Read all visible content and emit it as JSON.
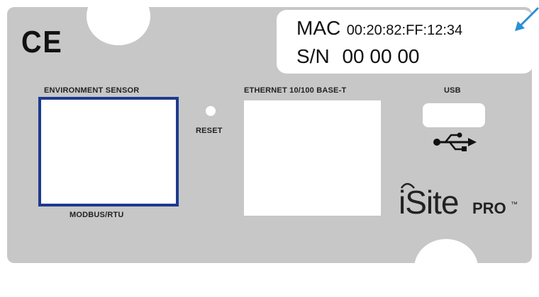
{
  "panel": {
    "ce_mark": "CE",
    "mac_label": "MAC",
    "mac_address": "00:20:82:FF:12:34",
    "sn_label": "S/N",
    "serial_number": "00 00 00",
    "env_sensor_label": "ENVIRONMENT SENSOR",
    "modbus_label": "MODBUS/RTU",
    "reset_label": "RESET",
    "ethernet_label": "ETHERNET 10/100 BASE-T",
    "usb_label": "USB",
    "logo_text": "iSite",
    "logo_suffix": "PRO",
    "logo_tm": "™"
  },
  "icons": {
    "pointer": "arrow-icon",
    "usb": "usb-icon"
  },
  "colors": {
    "panel": "#c7c7c7",
    "port_border": "#1c3a8f",
    "arrow": "#2b8fd6"
  }
}
